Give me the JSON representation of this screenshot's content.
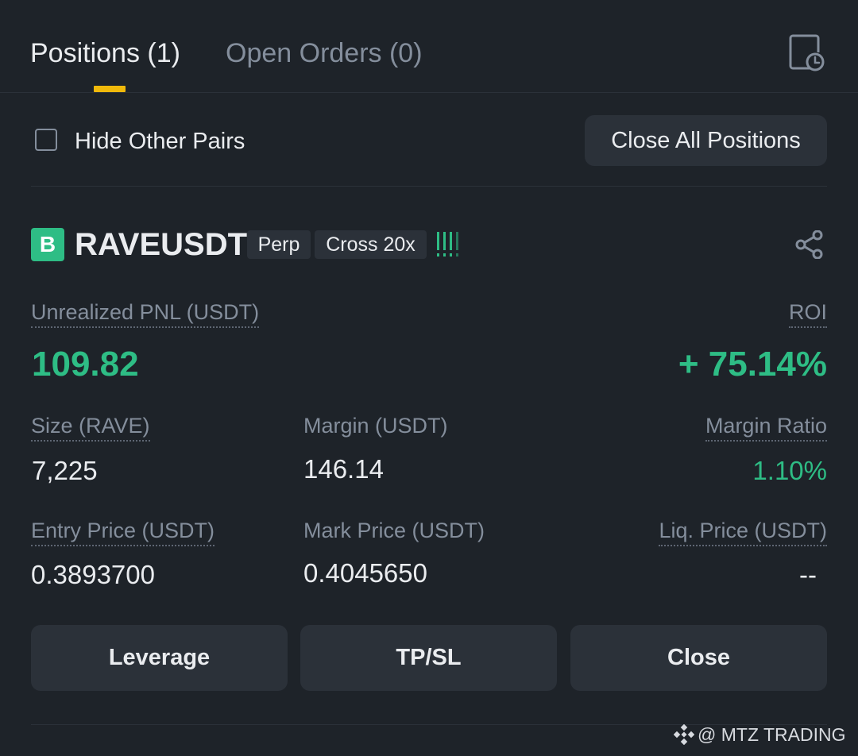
{
  "tabs": [
    {
      "label": "Positions (1)",
      "active": true
    },
    {
      "label": "Open Orders (0)",
      "active": false
    }
  ],
  "filter": {
    "hide_other_pairs_label": "Hide Other Pairs",
    "hide_other_pairs_checked": false,
    "close_all_label": "Close All Positions"
  },
  "position": {
    "side_badge": "B",
    "symbol": "RAVEUSDT",
    "contract_type": "Perp",
    "margin_mode": "Cross 20x",
    "risk_indicator": "!!!!",
    "unrealized_pnl_label": "Unrealized PNL (USDT)",
    "unrealized_pnl": "109.82",
    "roi_label": "ROI",
    "roi": "+ 75.14%",
    "size_label": "Size (RAVE)",
    "size": "7,225",
    "margin_label": "Margin (USDT)",
    "margin": "146.14",
    "margin_ratio_label": "Margin Ratio",
    "margin_ratio": "1.10%",
    "entry_price_label": "Entry Price (USDT)",
    "entry_price": "0.3893700",
    "mark_price_label": "Mark Price (USDT)",
    "mark_price": "0.4045650",
    "liq_price_label": "Liq. Price (USDT)",
    "liq_price": "--"
  },
  "actions": {
    "leverage_label": "Leverage",
    "tpsl_label": "TP/SL",
    "close_label": "Close"
  },
  "watermark": {
    "text": "@ MTZ TRADING"
  },
  "icons": {
    "history": "history-clock-icon",
    "share": "share-icon",
    "watermark_logo": "diamond-logo-icon"
  },
  "colors": {
    "background": "#1e2329",
    "panel": "#2b3139",
    "accent_yellow": "#f0b90b",
    "profit_green": "#2ebd85",
    "text_primary": "#eaecef",
    "text_secondary": "#848e9c"
  }
}
